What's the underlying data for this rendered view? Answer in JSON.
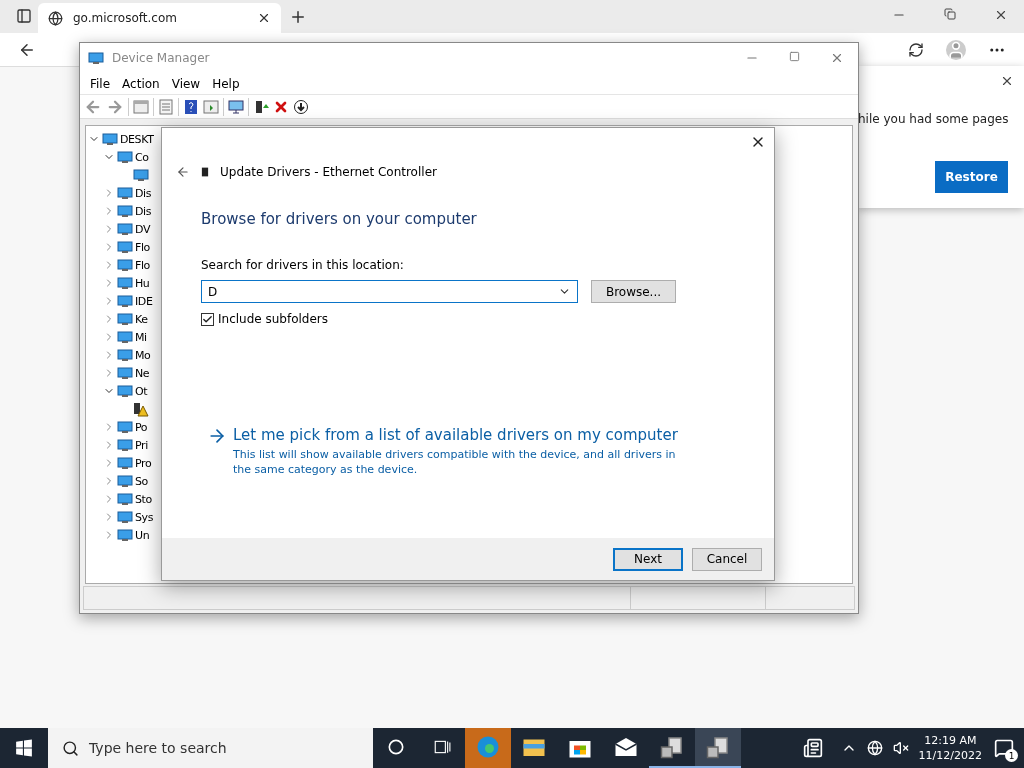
{
  "browser": {
    "tab": {
      "title": "go.microsoft.com"
    },
    "restore_popup": {
      "message": "hile you had some pages",
      "button": "Restore"
    }
  },
  "device_manager": {
    "title": "Device Manager",
    "menu": [
      {
        "label": "File"
      },
      {
        "label": "Action"
      },
      {
        "label": "View"
      },
      {
        "label": "Help"
      }
    ],
    "tree": [
      {
        "label": "DESKT",
        "expanded": true,
        "children": [
          {
            "label": "Co",
            "expanded": true,
            "children": [
              {
                "kind": "device"
              }
            ]
          },
          {
            "label": "Dis",
            "expanded": false
          },
          {
            "label": "Dis",
            "expanded": false
          },
          {
            "label": "DV",
            "expanded": false
          },
          {
            "label": "Flo",
            "expanded": false
          },
          {
            "label": "Flo",
            "expanded": false
          },
          {
            "label": "Hu",
            "expanded": false
          },
          {
            "label": "IDE",
            "expanded": false
          },
          {
            "label": "Ke",
            "expanded": false
          },
          {
            "label": "Mi",
            "expanded": false
          },
          {
            "label": "Mo",
            "expanded": false
          },
          {
            "label": "Ne",
            "expanded": false
          },
          {
            "label": "Ot",
            "expanded": true,
            "children": [
              {
                "kind": "warning"
              }
            ]
          },
          {
            "label": "Po",
            "expanded": false
          },
          {
            "label": "Pri",
            "expanded": false
          },
          {
            "label": "Pro",
            "expanded": false
          },
          {
            "label": "So",
            "expanded": false
          },
          {
            "label": "Sto",
            "expanded": false
          },
          {
            "label": "Sys",
            "expanded": false
          },
          {
            "label": "Un",
            "expanded": false
          }
        ]
      }
    ]
  },
  "dialog": {
    "title": "Update Drivers - Ethernet Controller",
    "heading": "Browse for drivers on your computer",
    "field_label": "Search for drivers in this location:",
    "location": {
      "value": "D"
    },
    "browse_button": "Browse...",
    "include_subfolders": {
      "label": "Include subfolders",
      "checked": true
    },
    "pick_link": {
      "label": "Let me pick from a list of available drivers on my computer",
      "description": "This list will show available drivers compatible with the device, and all drivers in the same category as the device."
    },
    "buttons": [
      {
        "label": "Next",
        "default": true
      },
      {
        "label": "Cancel",
        "default": false
      }
    ]
  },
  "taskbar": {
    "search": {
      "placeholder": "Type here to search"
    },
    "apps": [
      {
        "kind": "edge",
        "hovered": true,
        "running": false,
        "selected": false
      },
      {
        "kind": "folder",
        "hovered": false,
        "running": false,
        "selected": false
      },
      {
        "kind": "store",
        "hovered": false,
        "running": false,
        "selected": false
      },
      {
        "kind": "mail",
        "hovered": false,
        "running": false,
        "selected": false
      },
      {
        "kind": "device",
        "hovered": false,
        "running": true,
        "selected": false
      },
      {
        "kind": "device",
        "hovered": false,
        "running": true,
        "selected": true
      }
    ],
    "time": "12:19 AM",
    "date": "11/12/2022",
    "notifications": "1"
  }
}
